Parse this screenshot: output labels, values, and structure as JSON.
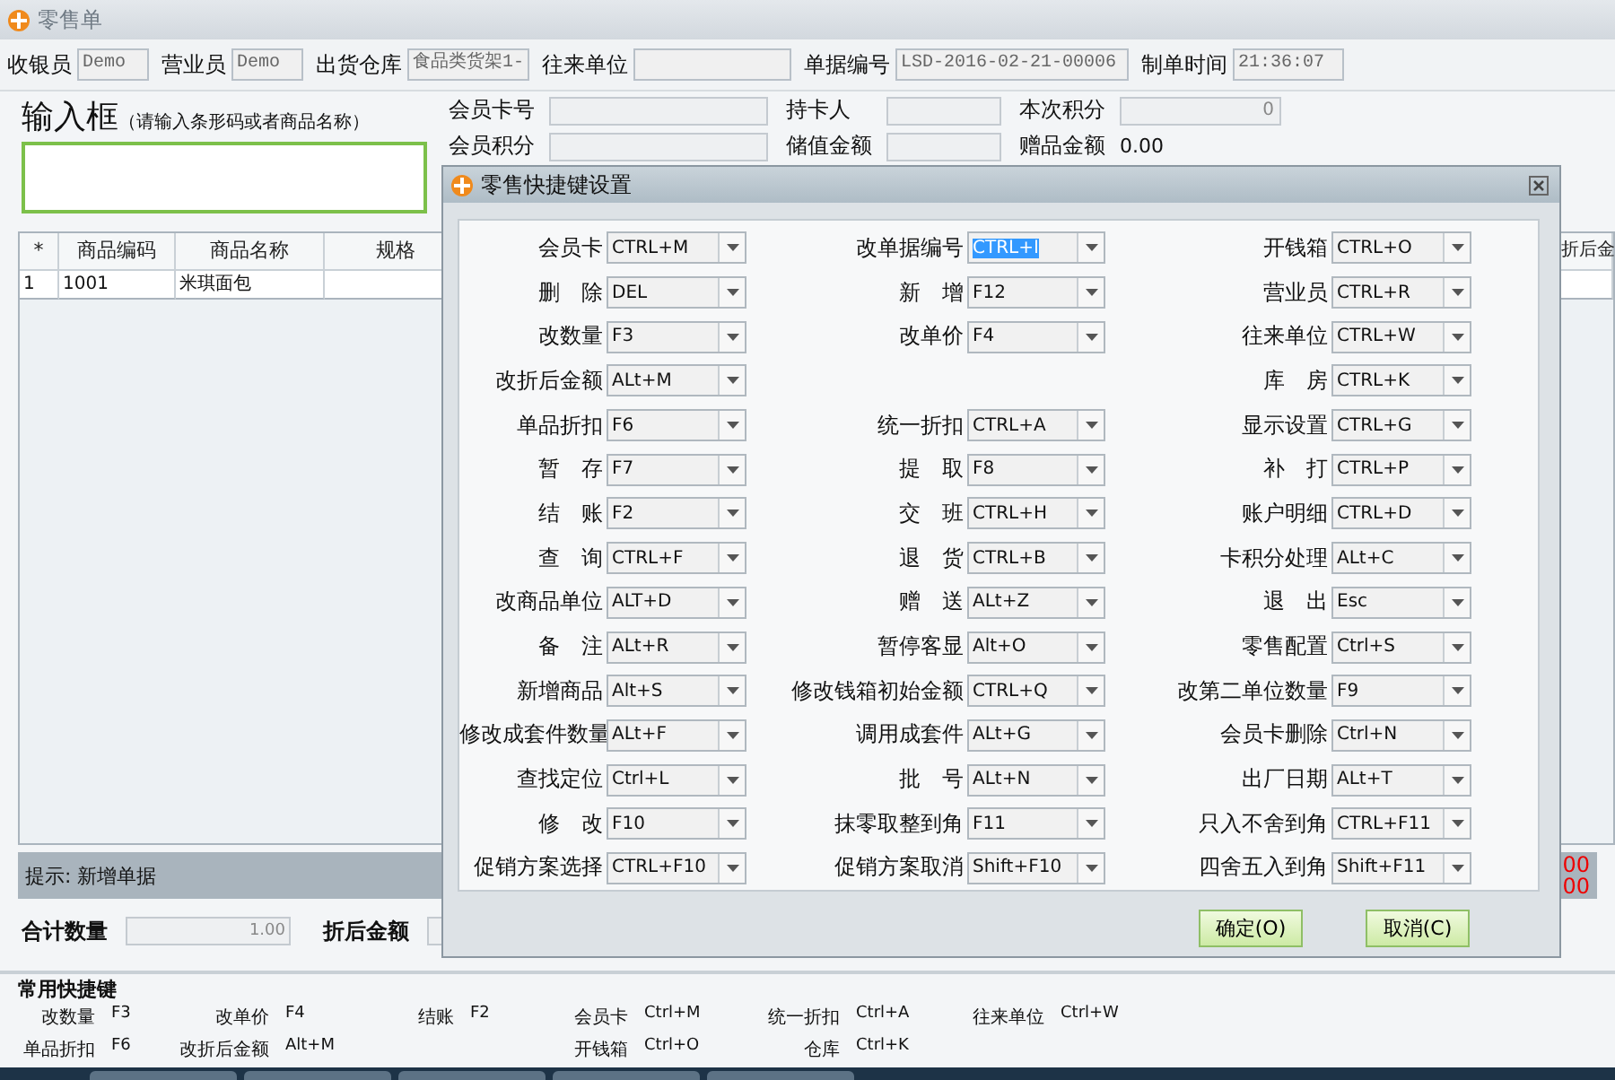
{
  "window": {
    "title": "零售单"
  },
  "header": [
    {
      "label": "收银员",
      "value": "Demo"
    },
    {
      "label": "营业员",
      "value": "Demo"
    },
    {
      "label": "出货仓库",
      "value": "食品类货架1-"
    },
    {
      "label": "往来单位"
    },
    {
      "label": "单据编号",
      "value": "LSD-2016-02-21-00006"
    },
    {
      "label": "制单时间",
      "value": "21:36:07"
    }
  ],
  "input_box": {
    "title": "输入框",
    "hint": "（请输入条形码或者商品名称）"
  },
  "member": [
    {
      "label": "会员卡号"
    },
    {
      "label": "持卡人"
    },
    {
      "label": "本次积分",
      "value": "0"
    },
    {
      "label": "会员积分"
    },
    {
      "label": "储值金额"
    },
    {
      "label": "赠品金额",
      "value": "0.00",
      "kind": "text"
    }
  ],
  "table": {
    "columns": [
      "*",
      "商品编码",
      "商品名称",
      "规格",
      "折后金"
    ],
    "rows": [
      [
        "1",
        "1001",
        "米琪面包",
        "",
        ""
      ]
    ]
  },
  "hint_bar": {
    "text": "提示:  新增单据",
    "values": [
      "00",
      "00"
    ]
  },
  "totals": [
    {
      "label": "合计数量",
      "value": "1.00"
    },
    {
      "label": "折后金额"
    }
  ],
  "common_shortcuts": {
    "title": "常用快捷键",
    "rows": [
      [
        {
          "kind": "pair",
          "label": "改数量",
          "key": "F3"
        },
        {
          "kind": "pair",
          "label": "改单价",
          "key": "F4"
        },
        {
          "kind": "pair",
          "label": "结账",
          "key": "F2"
        },
        {
          "kind": "pair",
          "label": "会员卡",
          "key": "Ctrl+M"
        },
        {
          "kind": "pair",
          "label": "统一折扣",
          "key": "Ctrl+A"
        },
        {
          "kind": "pair",
          "label": "往来单位",
          "key": "Ctrl+W"
        }
      ],
      [
        {
          "kind": "pair",
          "label": "单品折扣",
          "key": "F6"
        },
        {
          "kind": "pair",
          "label": "改折后金额",
          "key": "Alt+M"
        },
        {
          "kind": "empty"
        },
        {
          "kind": "pair",
          "label": "开钱箱",
          "key": "Ctrl+O"
        },
        {
          "kind": "pair",
          "label": "仓库",
          "key": "Ctrl+K"
        },
        {
          "kind": "empty"
        }
      ]
    ]
  },
  "dialog": {
    "title": "零售快捷键设置",
    "rows": [
      [
        {
          "kind": "combo",
          "label": "会员卡",
          "key": "CTRL+M",
          "selected": false
        },
        {
          "kind": "combo",
          "label": "改单据编号",
          "key": "CTRL+I",
          "selected": true
        },
        {
          "kind": "combo",
          "label": "开钱箱",
          "key": "CTRL+O",
          "selected": false
        }
      ],
      [
        {
          "kind": "combo",
          "label": "删　除",
          "key": "DEL",
          "selected": false
        },
        {
          "kind": "combo",
          "label": "新　增",
          "key": "F12",
          "selected": false
        },
        {
          "kind": "combo",
          "label": "营业员",
          "key": "CTRL+R",
          "selected": false
        }
      ],
      [
        {
          "kind": "combo",
          "label": "改数量",
          "key": "F3",
          "selected": false
        },
        {
          "kind": "combo",
          "label": "改单价",
          "key": "F4",
          "selected": false
        },
        {
          "kind": "combo",
          "label": "往来单位",
          "key": "CTRL+W",
          "selected": false
        }
      ],
      [
        {
          "kind": "combo",
          "label": "改折后金额",
          "key": "ALt+M",
          "selected": false
        },
        {
          "kind": "empty"
        },
        {
          "kind": "combo",
          "label": "库　房",
          "key": "CTRL+K",
          "selected": false
        }
      ],
      [
        {
          "kind": "combo",
          "label": "单品折扣",
          "key": "F6",
          "selected": false
        },
        {
          "kind": "combo",
          "label": "统一折扣",
          "key": "CTRL+A",
          "selected": false
        },
        {
          "kind": "combo",
          "label": "显示设置",
          "key": "CTRL+G",
          "selected": false
        }
      ],
      [
        {
          "kind": "combo",
          "label": "暂　存",
          "key": "F7",
          "selected": false
        },
        {
          "kind": "combo",
          "label": "提　取",
          "key": "F8",
          "selected": false
        },
        {
          "kind": "combo",
          "label": "补　打",
          "key": "CTRL+P",
          "selected": false
        }
      ],
      [
        {
          "kind": "combo",
          "label": "结　账",
          "key": "F2",
          "selected": false
        },
        {
          "kind": "combo",
          "label": "交　班",
          "key": "CTRL+H",
          "selected": false
        },
        {
          "kind": "combo",
          "label": "账户明细",
          "key": "CTRL+D",
          "selected": false
        }
      ],
      [
        {
          "kind": "combo",
          "label": "查　询",
          "key": "CTRL+F",
          "selected": false
        },
        {
          "kind": "combo",
          "label": "退　货",
          "key": "CTRL+B",
          "selected": false
        },
        {
          "kind": "combo",
          "label": "卡积分处理",
          "key": "ALt+C",
          "selected": false
        }
      ],
      [
        {
          "kind": "combo",
          "label": "改商品单位",
          "key": "ALT+D",
          "selected": false
        },
        {
          "kind": "combo",
          "label": "赠　送",
          "key": "ALt+Z",
          "selected": false
        },
        {
          "kind": "combo",
          "label": "退　出",
          "key": "Esc",
          "selected": false
        }
      ],
      [
        {
          "kind": "combo",
          "label": "备　注",
          "key": "ALt+R",
          "selected": false
        },
        {
          "kind": "combo",
          "label": "暂停客显",
          "key": "Alt+O",
          "selected": false
        },
        {
          "kind": "combo",
          "label": "零售配置",
          "key": "Ctrl+S",
          "selected": false
        }
      ],
      [
        {
          "kind": "combo",
          "label": "新增商品",
          "key": "Alt+S",
          "selected": false
        },
        {
          "kind": "combo",
          "label": "修改钱箱初始金额",
          "key": "CTRL+Q",
          "selected": false
        },
        {
          "kind": "combo",
          "label": "改第二单位数量",
          "key": "F9",
          "selected": false
        }
      ],
      [
        {
          "kind": "combo",
          "label": "修改成套件数量",
          "key": "ALt+F",
          "selected": false
        },
        {
          "kind": "combo",
          "label": "调用成套件",
          "key": "ALt+G",
          "selected": false
        },
        {
          "kind": "combo",
          "label": "会员卡删除",
          "key": "Ctrl+N",
          "selected": false
        }
      ],
      [
        {
          "kind": "combo",
          "label": "查找定位",
          "key": "Ctrl+L",
          "selected": false
        },
        {
          "kind": "combo",
          "label": "批　号",
          "key": "ALt+N",
          "selected": false
        },
        {
          "kind": "combo",
          "label": "出厂日期",
          "key": "ALt+T",
          "selected": false
        }
      ],
      [
        {
          "kind": "combo",
          "label": "修　改",
          "key": "F10",
          "selected": false
        },
        {
          "kind": "combo",
          "label": "抹零取整到角",
          "key": "F11",
          "selected": false
        },
        {
          "kind": "combo",
          "label": "只入不舍到角",
          "key": "CTRL+F11",
          "selected": false
        }
      ],
      [
        {
          "kind": "combo",
          "label": "促销方案选择",
          "key": "CTRL+F10",
          "selected": false
        },
        {
          "kind": "combo",
          "label": "促销方案取消",
          "key": "Shift+F10",
          "selected": false
        },
        {
          "kind": "combo",
          "label": "四舍五入到角",
          "key": "Shift+F11",
          "selected": false
        }
      ]
    ],
    "buttons": [
      "确定(O)",
      "取消(C)"
    ]
  }
}
